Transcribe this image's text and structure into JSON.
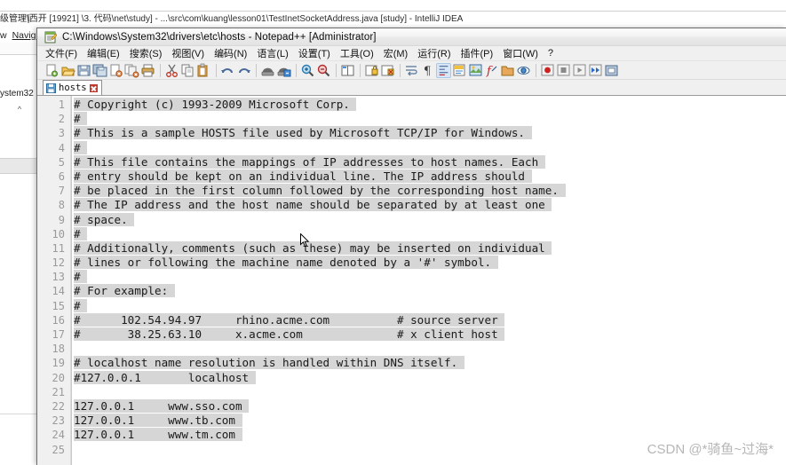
{
  "idea": {
    "title": "级管理\\西开  [19921] \\3. 代码\\net\\study] - ...\\src\\com\\kuang\\lesson01\\TestInetSocketAddress.java [study] - IntelliJ IDEA",
    "menu_visible": [
      "w",
      "Navigat"
    ],
    "sidebar_label": "ystem32",
    "collapse_caret": "^"
  },
  "notepadpp": {
    "title": "C:\\Windows\\System32\\drivers\\etc\\hosts - Notepad++ [Administrator]",
    "icon": "notepad-document-icon",
    "menu": [
      "文件(F)",
      "编辑(E)",
      "搜索(S)",
      "视图(V)",
      "编码(N)",
      "语言(L)",
      "设置(T)",
      "工具(O)",
      "宏(M)",
      "运行(R)",
      "插件(P)",
      "窗口(W)",
      "?"
    ],
    "toolbar": [
      {
        "name": "new-file-icon"
      },
      {
        "name": "open-file-icon"
      },
      {
        "name": "save-icon"
      },
      {
        "name": "save-all-icon"
      },
      {
        "name": "close-file-icon"
      },
      {
        "name": "close-all-files-icon"
      },
      {
        "name": "print-icon"
      },
      {
        "sep": true
      },
      {
        "name": "cut-icon"
      },
      {
        "name": "copy-icon"
      },
      {
        "name": "paste-icon"
      },
      {
        "sep": true
      },
      {
        "name": "undo-icon"
      },
      {
        "name": "redo-icon"
      },
      {
        "sep": true
      },
      {
        "name": "find-icon"
      },
      {
        "name": "replace-icon"
      },
      {
        "sep": true
      },
      {
        "name": "zoom-in-icon"
      },
      {
        "name": "zoom-out-icon"
      },
      {
        "sep": true
      },
      {
        "name": "sync-vertical-scroll-icon"
      },
      {
        "sep": true
      },
      {
        "name": "toggle-bookmark-icon"
      },
      {
        "name": "clear-bookmarks-icon"
      },
      {
        "sep": true
      },
      {
        "name": "word-wrap-icon"
      },
      {
        "name": "show-all-characters-icon"
      },
      {
        "name": "indent-guide-icon"
      },
      {
        "name": "user-defined-language-icon"
      },
      {
        "name": "show-document-map-icon"
      },
      {
        "name": "function-list-icon"
      },
      {
        "name": "folder-as-workspace-icon"
      },
      {
        "name": "monitoring-icon"
      },
      {
        "sep": true
      },
      {
        "name": "start-record-macro-icon"
      },
      {
        "name": "stop-record-macro-icon"
      },
      {
        "name": "playback-macro-icon"
      },
      {
        "name": "run-macro-multiple-icon"
      },
      {
        "name": "save-current-macro-icon"
      }
    ],
    "tab": {
      "label": "hosts",
      "close": "close-tab-icon"
    },
    "editor": {
      "first_line_number": 1,
      "total_visible_lines": 25,
      "lines": [
        {
          "n": 1,
          "text": "# Copyright (c) 1993-2009 Microsoft Corp."
        },
        {
          "n": 2,
          "text": "#"
        },
        {
          "n": 3,
          "text": "# This is a sample HOSTS file used by Microsoft TCP/IP for Windows."
        },
        {
          "n": 4,
          "text": "#"
        },
        {
          "n": 5,
          "text": "# This file contains the mappings of IP addresses to host names. Each"
        },
        {
          "n": 6,
          "text": "# entry should be kept on an individual line. The IP address should"
        },
        {
          "n": 7,
          "text": "# be placed in the first column followed by the corresponding host name."
        },
        {
          "n": 8,
          "text": "# The IP address and the host name should be separated by at least one"
        },
        {
          "n": 9,
          "text": "# space."
        },
        {
          "n": 10,
          "text": "#"
        },
        {
          "n": 11,
          "text": "# Additionally, comments (such as these) may be inserted on individual"
        },
        {
          "n": 12,
          "text": "# lines or following the machine name denoted by a '#' symbol."
        },
        {
          "n": 13,
          "text": "#"
        },
        {
          "n": 14,
          "text": "# For example:"
        },
        {
          "n": 15,
          "text": "#"
        },
        {
          "n": 16,
          "text": "#      102.54.94.97     rhino.acme.com          # source server"
        },
        {
          "n": 17,
          "text": "#       38.25.63.10     x.acme.com              # x client host"
        },
        {
          "n": 18,
          "text": ""
        },
        {
          "n": 19,
          "text": "# localhost name resolution is handled within DNS itself."
        },
        {
          "n": 20,
          "text": "#127.0.0.1       localhost"
        },
        {
          "n": 21,
          "text": ""
        },
        {
          "n": 22,
          "text": "127.0.0.1     www.sso.com"
        },
        {
          "n": 23,
          "text": "127.0.0.1     www.tb.com"
        },
        {
          "n": 24,
          "text": "127.0.0.1     www.tm.com"
        },
        {
          "n": 25,
          "text": ""
        }
      ]
    }
  },
  "watermark": "CSDN @*骑鱼~过海*",
  "colors": {
    "selection_highlight": "#d6d6d6",
    "gutter_bg": "#f0f0f0",
    "gutter_text": "#9a9a9a",
    "editor_bg": "#ffffff",
    "chrome_bg": "#f0f0f0",
    "tab_close_red": "#c0392b",
    "watermark_gray": "#b6b6b6"
  }
}
